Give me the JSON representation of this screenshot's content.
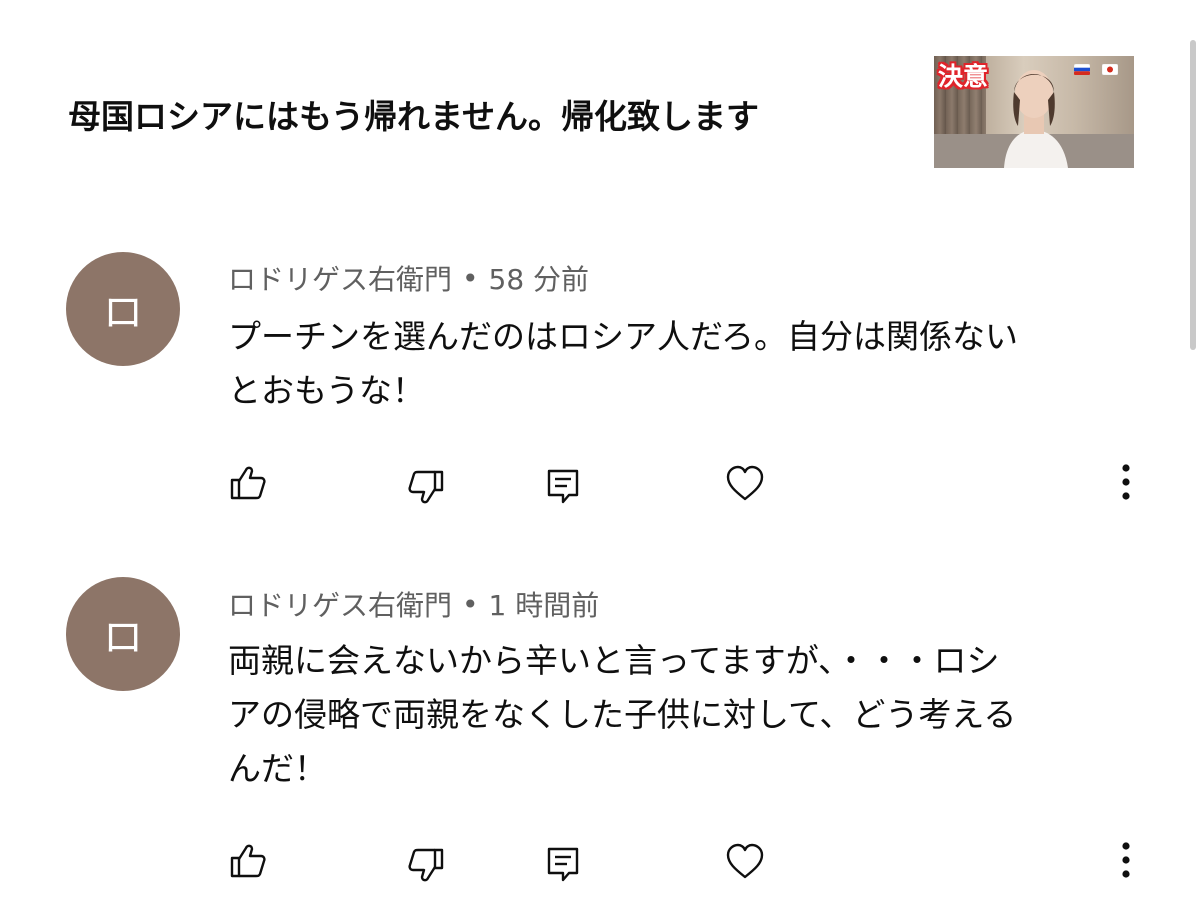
{
  "video": {
    "title": "母国ロシアにはもう帰れません。帰化致します",
    "thumbnail_text": "決意",
    "thumbnail_flags": [
      "russia-flag-icon",
      "japan-flag-icon"
    ]
  },
  "comments": [
    {
      "avatar_letter": "ロ",
      "author": "ロドリゲス右衛門",
      "separator": "•",
      "time": "58 分前",
      "text_lines": [
        "プーチンを選んだのはロシア人だろ。自分は関係ない",
        "とおもうな！"
      ]
    },
    {
      "avatar_letter": "ロ",
      "author": "ロドリゲス右衛門",
      "separator": "•",
      "time": "1 時間前",
      "text_lines": [
        "両親に会えないから辛いと言ってますが、・・・ロシ",
        "アの侵略で両親をなくした子供に対して、どう考える",
        "んだ！"
      ]
    }
  ],
  "icons": {
    "like": "thumbs-up-icon",
    "dislike": "thumbs-down-icon",
    "reply": "reply-icon",
    "heart": "heart-icon",
    "more": "more-vertical-icon"
  },
  "colors": {
    "avatar": "#8d7568",
    "meta_text": "#606060",
    "body_text": "#0f0f0f",
    "thumb_text_outline": "#e0242b"
  }
}
